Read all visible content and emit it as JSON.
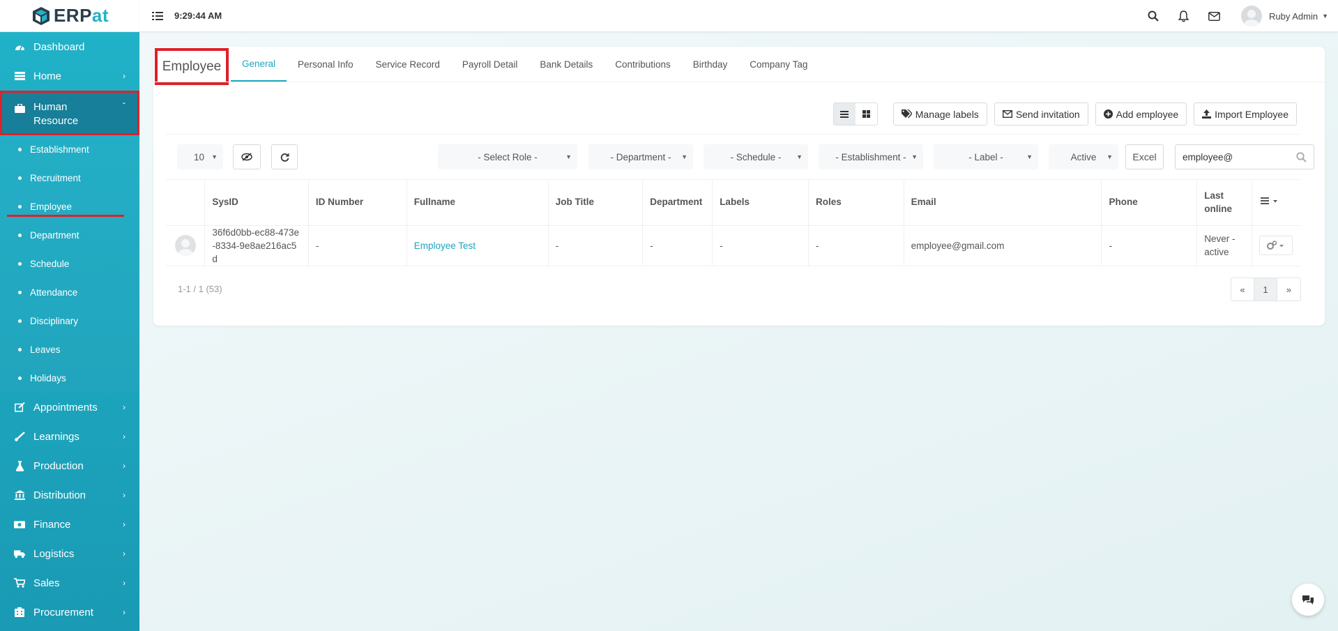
{
  "app": {
    "logo_prefix": "ERP",
    "logo_suffix": "at"
  },
  "topbar": {
    "time": "9:29:44 AM",
    "user_name": "Ruby Admin"
  },
  "sidebar": {
    "items_top": [
      {
        "label": "Dashboard",
        "icon": "dashboard-icon"
      },
      {
        "label": "Home",
        "icon": "home-list-icon"
      }
    ],
    "active_module": {
      "label": "Human Resource",
      "icon": "briefcase-icon"
    },
    "subitems": [
      "Establishment",
      "Recruitment",
      "Employee",
      "Department",
      "Schedule",
      "Attendance",
      "Disciplinary",
      "Leaves",
      "Holidays"
    ],
    "items_bottom": [
      {
        "label": "Appointments",
        "icon": "edit-icon"
      },
      {
        "label": "Learnings",
        "icon": "brush-icon"
      },
      {
        "label": "Production",
        "icon": "flask-icon"
      },
      {
        "label": "Distribution",
        "icon": "bank-icon"
      },
      {
        "label": "Finance",
        "icon": "money-icon"
      },
      {
        "label": "Logistics",
        "icon": "truck-icon"
      },
      {
        "label": "Sales",
        "icon": "cart-icon"
      },
      {
        "label": "Procurement",
        "icon": "building-icon"
      }
    ]
  },
  "page": {
    "title": "Employee",
    "tabs": [
      "General",
      "Personal Info",
      "Service Record",
      "Payroll Detail",
      "Bank Details",
      "Contributions",
      "Birthday",
      "Company Tag"
    ],
    "active_tab": "General"
  },
  "actions": {
    "manage_labels": "Manage labels",
    "send_invitation": "Send invitation",
    "add_employee": "Add employee",
    "import_employee": "Import Employee"
  },
  "filters": {
    "page_size": "10",
    "role": "- Select Role -",
    "department": "- Department -",
    "schedule": "- Schedule -",
    "establishment": "- Establishment -",
    "label": "- Label -",
    "status": "Active",
    "excel": "Excel",
    "search_value": "employee@"
  },
  "table": {
    "columns": [
      "",
      "SysID",
      "ID Number",
      "Fullname",
      "Job Title",
      "Department",
      "Labels",
      "Roles",
      "Email",
      "Phone",
      "Last online",
      ""
    ],
    "rows": [
      {
        "sysid": "36f6d0bb-ec88-473e-8334-9e8ae216ac5d",
        "id_number": "-",
        "fullname": "Employee Test",
        "job_title": "-",
        "department": "-",
        "labels": "-",
        "roles": "-",
        "email": "employee@gmail.com",
        "phone": "-",
        "last_online": "Never - active"
      }
    ]
  },
  "pagination": {
    "summary": "1-1 / 1 (53)",
    "prev": "«",
    "current": "1",
    "next": "»"
  },
  "colors": {
    "accent": "#1da5bd",
    "sidebar": "#21b3c9",
    "highlight": "#e0202a"
  }
}
